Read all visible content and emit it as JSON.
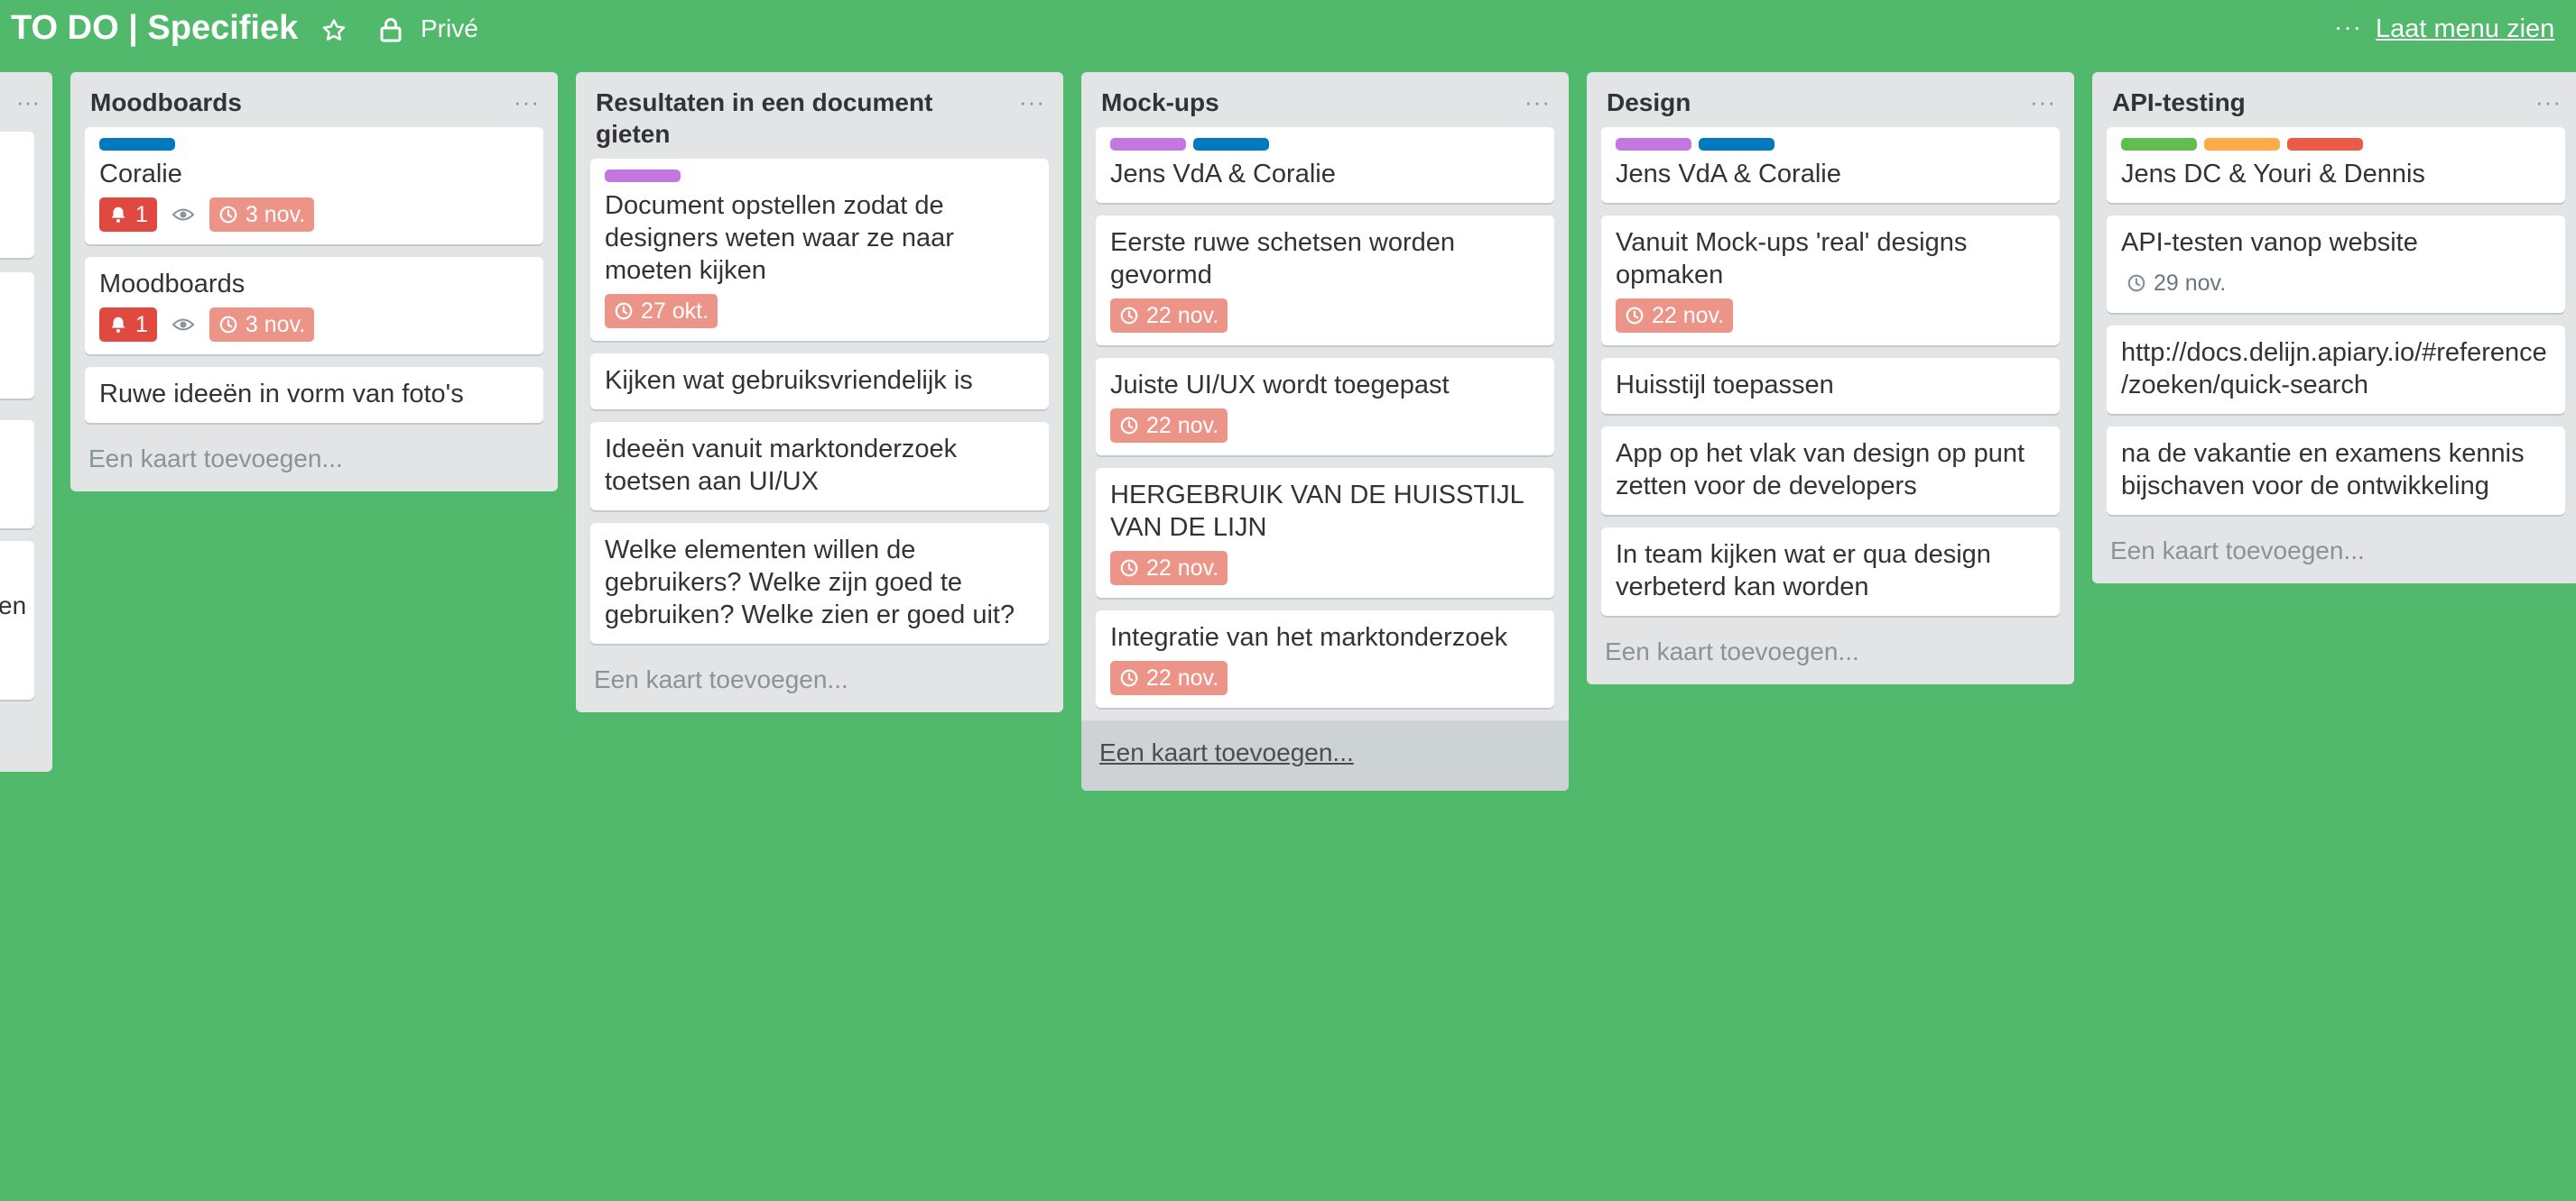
{
  "header": {
    "board_title": "TO DO | Specifiek",
    "visibility": "Privé",
    "more_glyph": "···",
    "show_menu": "Laat menu zien"
  },
  "colors": {
    "background": "#51b96b",
    "label_blue": "#0079bf",
    "label_purple": "#c377e0",
    "label_green": "#61bd4f",
    "label_orange": "#ffab4a",
    "label_red": "#eb5a46",
    "badge_red": "#e0493f",
    "badge_salmon": "#ec9488"
  },
  "partial_list": {
    "text_fragment": "en"
  },
  "lists": [
    {
      "title": "Moodboards",
      "menu": "···",
      "cards": [
        {
          "labels": [
            "blue"
          ],
          "text": "Coralie",
          "notif": "1",
          "due": "3 nov."
        },
        {
          "labels": [],
          "text": "Moodboards",
          "notif": "1",
          "due": "3 nov."
        },
        {
          "labels": [],
          "text": "Ruwe ideeën in vorm van foto's"
        }
      ],
      "add": "Een kaart toevoegen..."
    },
    {
      "title": "Resultaten in een document gieten",
      "menu": "···",
      "cards": [
        {
          "labels": [
            "purple"
          ],
          "text": "Document opstellen zodat de designers weten waar ze naar moeten kijken",
          "due": "27 okt."
        },
        {
          "labels": [],
          "text": "Kijken wat gebruiksvriendelijk is"
        },
        {
          "labels": [],
          "text": "Ideeën vanuit marktonderzoek toetsen aan UI/UX"
        },
        {
          "labels": [],
          "text": "Welke elementen willen de gebruikers? Welke zijn goed te gebruiken? Welke zien er goed uit?"
        }
      ],
      "add": "Een kaart toevoegen..."
    },
    {
      "title": "Mock-ups",
      "menu": "···",
      "cards": [
        {
          "labels": [
            "purple",
            "blue"
          ],
          "text": "Jens VdA & Coralie"
        },
        {
          "labels": [],
          "text": "Eerste ruwe schetsen worden gevormd",
          "due": "22 nov."
        },
        {
          "labels": [],
          "text": "Juiste UI/UX wordt toegepast",
          "due": "22 nov."
        },
        {
          "labels": [],
          "text": "HERGEBRUIK VAN DE HUISSTIJL VAN DE LIJN",
          "due": "22 nov."
        },
        {
          "labels": [],
          "text": "Integratie van het marktonderzoek",
          "due": "22 nov."
        }
      ],
      "add": "Een kaart toevoegen..."
    },
    {
      "title": "Design",
      "menu": "···",
      "cards": [
        {
          "labels": [
            "purple",
            "blue"
          ],
          "text": "Jens VdA & Coralie"
        },
        {
          "labels": [],
          "text": "Vanuit Mock-ups 'real' designs opmaken",
          "due": "22 nov."
        },
        {
          "labels": [],
          "text": "Huisstijl toepassen"
        },
        {
          "labels": [],
          "text": "App op het vlak van design op punt zetten voor de developers"
        },
        {
          "labels": [],
          "text": "In team kijken wat er qua design verbeterd kan worden"
        }
      ],
      "add": "Een kaart toevoegen..."
    },
    {
      "title": "API-testing",
      "menu": "···",
      "cards": [
        {
          "labels": [
            "green",
            "orange",
            "red"
          ],
          "text": "Jens DC & Youri & Dennis"
        },
        {
          "labels": [],
          "text": "API-testen vanop website",
          "due_plain": "29 nov."
        },
        {
          "labels": [],
          "text": "http://docs.delijn.apiary.io/#reference/zoeken/quick-search"
        },
        {
          "labels": [],
          "text": "na de vakantie en examens kennis bijschaven voor de ontwikkeling"
        }
      ],
      "add": "Een kaart toevoegen..."
    }
  ]
}
